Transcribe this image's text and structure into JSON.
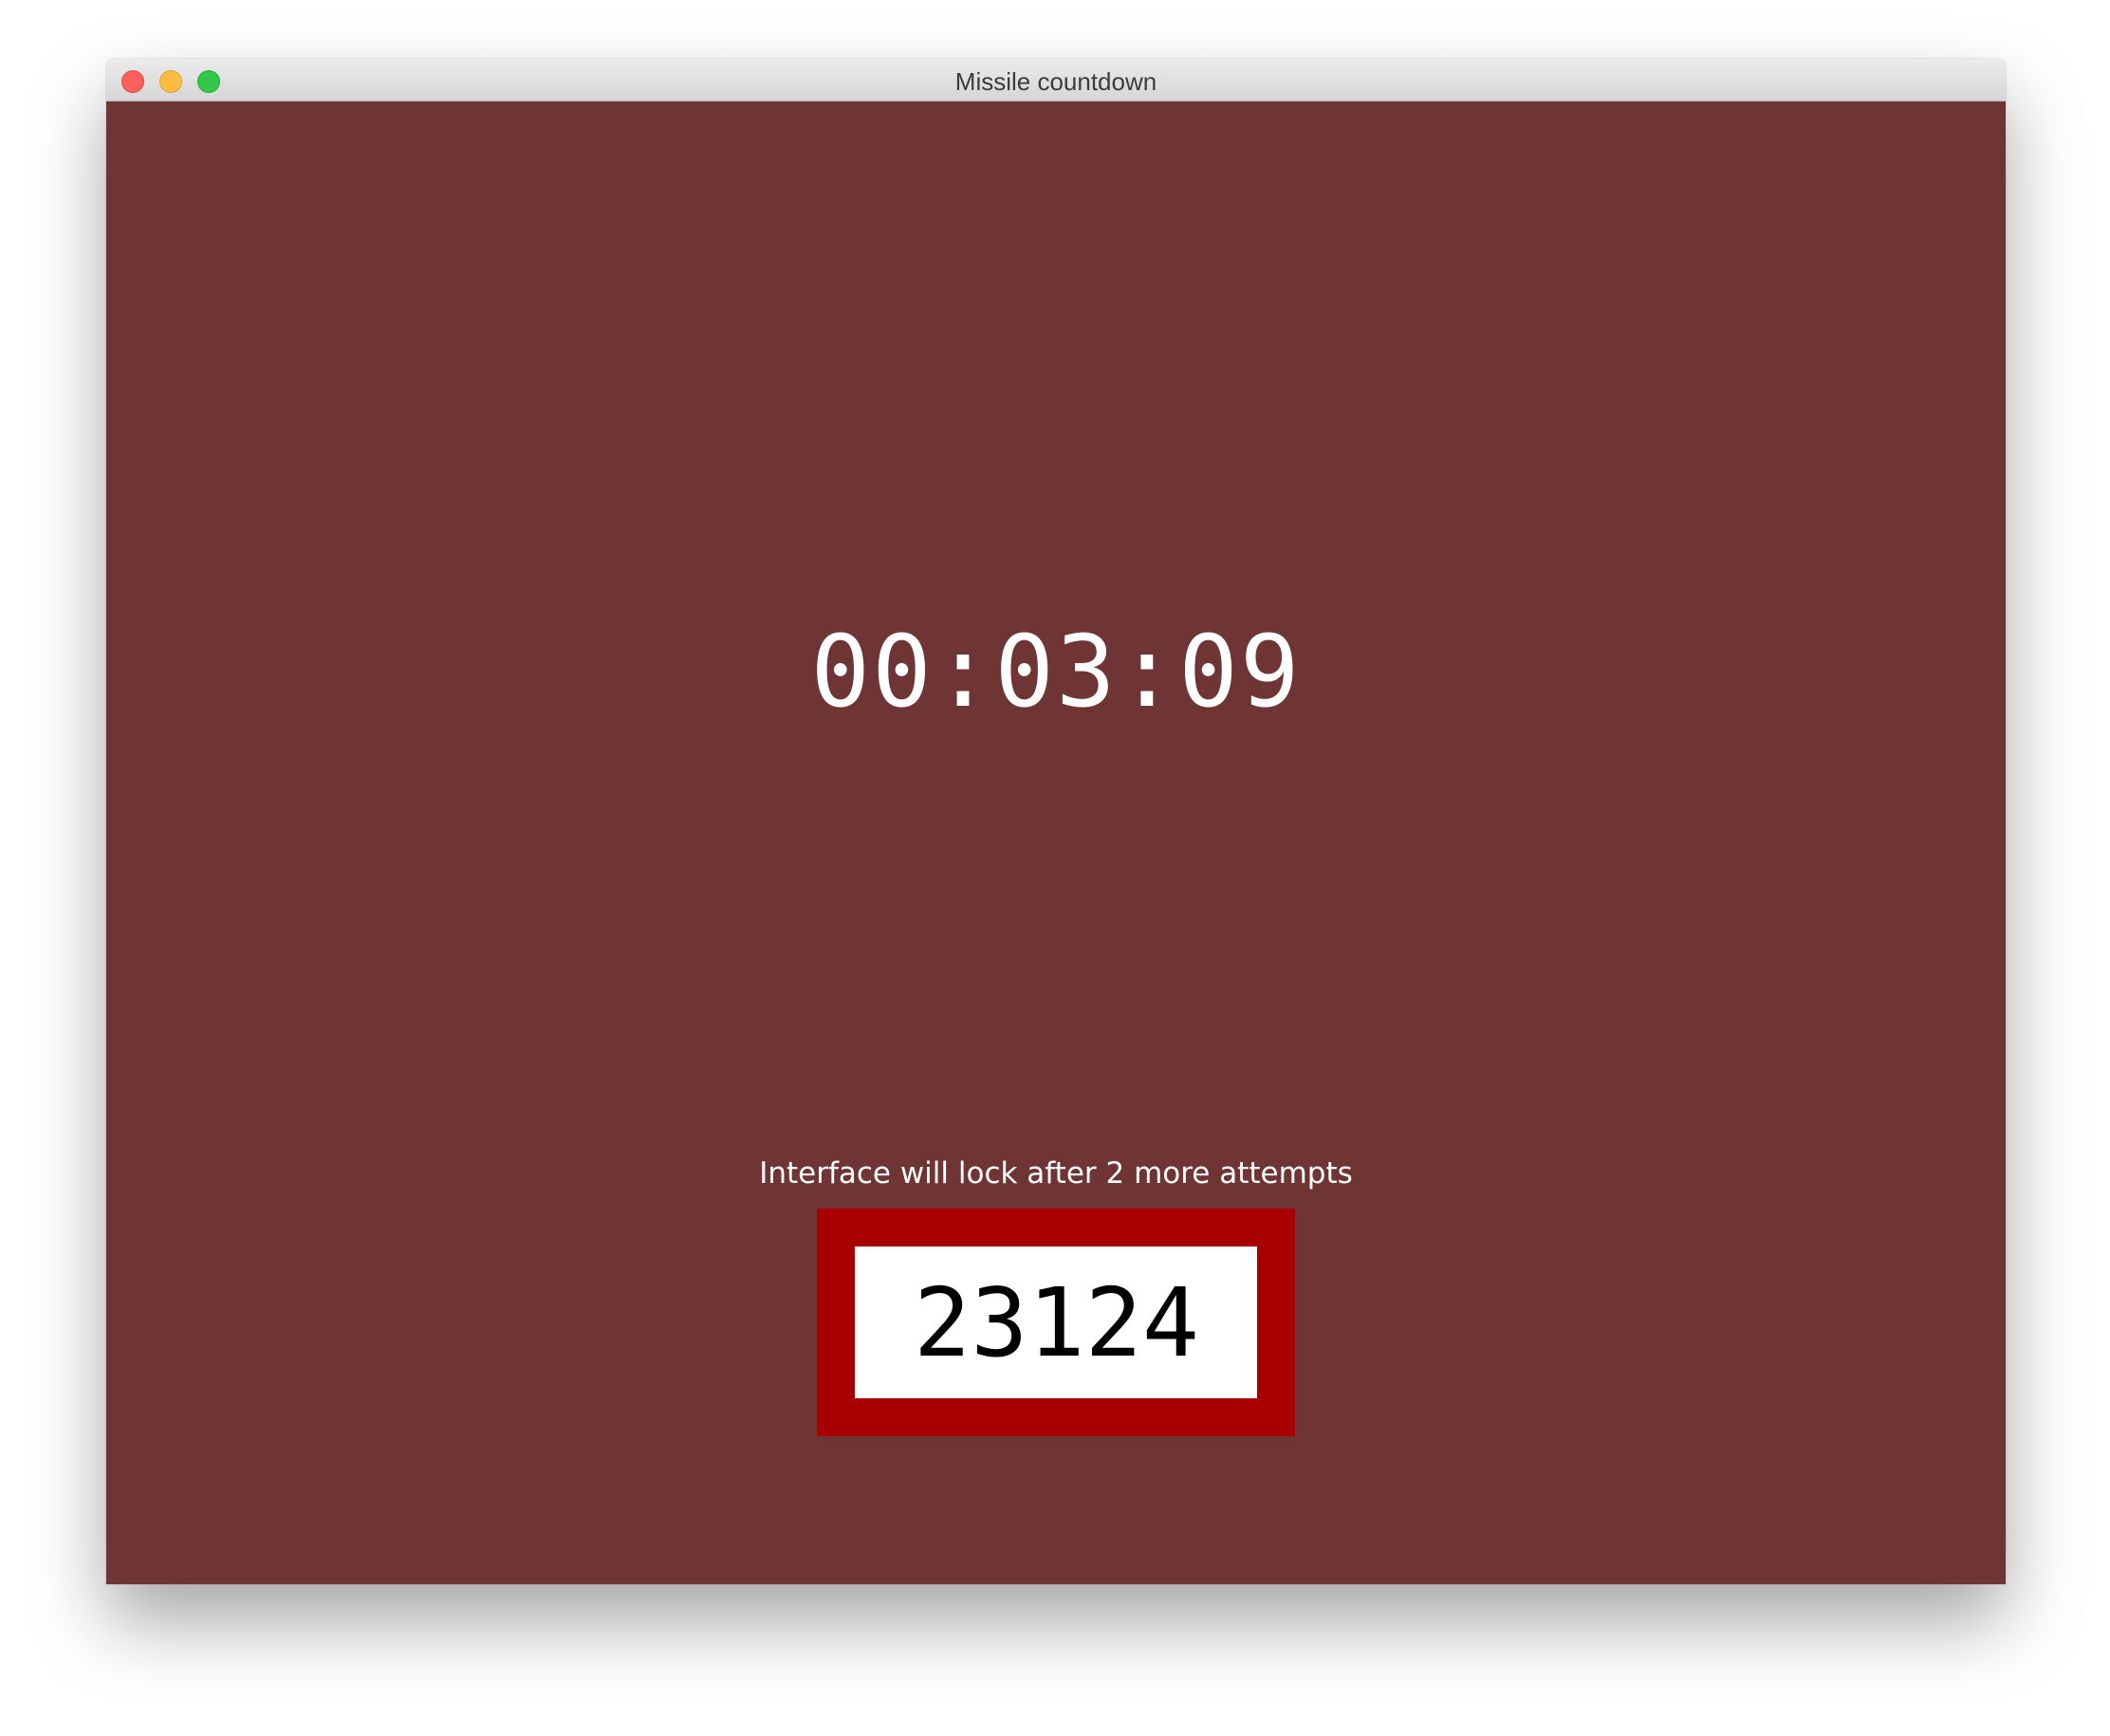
{
  "window": {
    "title": "Missile countdown"
  },
  "countdown": {
    "time": "00:03:09"
  },
  "lock": {
    "warning": "Interface will lock after 2 more attempts"
  },
  "code_entry": {
    "value": "23124"
  },
  "colors": {
    "background": "#6f3434",
    "frame": "#a80000",
    "text": "#ffffff"
  }
}
